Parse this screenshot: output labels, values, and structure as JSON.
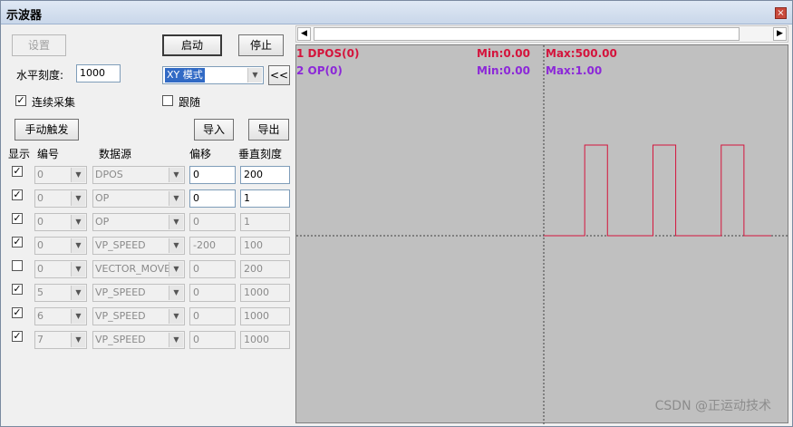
{
  "window": {
    "title": "示波器",
    "close_glyph": "×"
  },
  "buttons": {
    "settings": "设置",
    "start": "启动",
    "stop": "停止",
    "manual_trigger": "手动触发",
    "import": "导入",
    "export": "导出",
    "collapse": "<<"
  },
  "controls": {
    "h_scale_label": "水平刻度:",
    "h_scale_value": "1000",
    "mode_value": "XY 模式",
    "continuous_label": "连续采集",
    "follow_label": "跟随"
  },
  "table": {
    "headers": [
      "显示",
      "编号",
      "数据源",
      "偏移",
      "垂直刻度"
    ],
    "rows": [
      {
        "checked": true,
        "num": "0",
        "source": "DPOS",
        "offset": "0",
        "scale": "200",
        "editable": true
      },
      {
        "checked": true,
        "num": "0",
        "source": "OP",
        "offset": "0",
        "scale": "1",
        "editable": true
      },
      {
        "checked": true,
        "num": "0",
        "source": "OP",
        "offset": "0",
        "scale": "1",
        "editable": false
      },
      {
        "checked": true,
        "num": "0",
        "source": "VP_SPEED",
        "offset": "-200",
        "scale": "100",
        "editable": false
      },
      {
        "checked": false,
        "num": "0",
        "source": "VECTOR_MOVED",
        "offset": "0",
        "scale": "200",
        "editable": false
      },
      {
        "checked": true,
        "num": "5",
        "source": "VP_SPEED",
        "offset": "0",
        "scale": "1000",
        "editable": false
      },
      {
        "checked": true,
        "num": "6",
        "source": "VP_SPEED",
        "offset": "0",
        "scale": "1000",
        "editable": false
      },
      {
        "checked": true,
        "num": "7",
        "source": "VP_SPEED",
        "offset": "0",
        "scale": "1000",
        "editable": false
      }
    ]
  },
  "legend": [
    {
      "name": "1 DPOS(0)",
      "min": "Min:0.00",
      "max": "Max:500.00",
      "color": "#d4143c"
    },
    {
      "name": "2 OP(0)",
      "min": "Min:0.00",
      "max": "Max:1.00",
      "color": "#8c28d8"
    }
  ],
  "scroll_glyphs": {
    "left": "◀",
    "right": "▶"
  },
  "watermark": "CSDN @正运动技术",
  "colors": {
    "trace": "#d4143c",
    "scope_bg": "#c0c0c0",
    "axis": "#404040"
  },
  "waveform": {
    "description_levels": {
      "low": 0,
      "high": 500
    },
    "pulses": [
      {
        "start": 0.18,
        "end": 0.28
      },
      {
        "start": 0.48,
        "end": 0.58
      },
      {
        "start": 0.78,
        "end": 0.88
      }
    ]
  }
}
